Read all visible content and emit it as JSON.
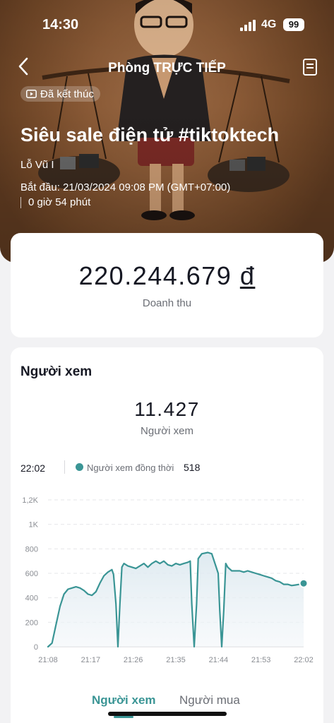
{
  "status_bar": {
    "time": "14:30",
    "network": "4G",
    "battery": "99"
  },
  "nav": {
    "title": "Phòng TRỰC TIẾP"
  },
  "live": {
    "status_badge": "Đã kết thúc",
    "title": "Siêu sale điện tử #tiktoktech",
    "host": "Lỗ Vũ I",
    "start_time": "Bắt đầu: 21/03/2024 09:08 PM (GMT+07:00)",
    "duration": "0 giờ 54 phút"
  },
  "revenue": {
    "amount": "220.244.679",
    "currency": "đ",
    "label": "Doanh thu"
  },
  "viewers": {
    "section_title": "Người xem",
    "total": "11.427",
    "total_label": "Người xem",
    "tooltip": {
      "time": "22:02",
      "series_label": "Người xem đồng thời",
      "value": "518"
    }
  },
  "chart_data": {
    "type": "line",
    "series": [
      {
        "name": "Người xem đồng thời",
        "color": "#3a9595",
        "points": [
          [
            0,
            0
          ],
          [
            1,
            30
          ],
          [
            2,
            180
          ],
          [
            3,
            330
          ],
          [
            4,
            430
          ],
          [
            5,
            470
          ],
          [
            6,
            480
          ],
          [
            7,
            490
          ],
          [
            8,
            480
          ],
          [
            9,
            460
          ],
          [
            10,
            430
          ],
          [
            11,
            420
          ],
          [
            12,
            450
          ],
          [
            13,
            520
          ],
          [
            14,
            580
          ],
          [
            15,
            610
          ],
          [
            16,
            630
          ],
          [
            16.4,
            590
          ],
          [
            17,
            350
          ],
          [
            17.5,
            0
          ],
          [
            18,
            350
          ],
          [
            18.5,
            650
          ],
          [
            19,
            680
          ],
          [
            20,
            660
          ],
          [
            21,
            650
          ],
          [
            22,
            640
          ],
          [
            23,
            660
          ],
          [
            24,
            680
          ],
          [
            25,
            650
          ],
          [
            26,
            680
          ],
          [
            27,
            700
          ],
          [
            28,
            680
          ],
          [
            29,
            700
          ],
          [
            30,
            670
          ],
          [
            31,
            660
          ],
          [
            32,
            680
          ],
          [
            33,
            670
          ],
          [
            34,
            680
          ],
          [
            35,
            690
          ],
          [
            35.6,
            700
          ],
          [
            36,
            350
          ],
          [
            36.6,
            0
          ],
          [
            37.2,
            350
          ],
          [
            37.6,
            720
          ],
          [
            38.5,
            760
          ],
          [
            40,
            770
          ],
          [
            41,
            760
          ],
          [
            42,
            660
          ],
          [
            42.6,
            600
          ],
          [
            43,
            300
          ],
          [
            43.5,
            0
          ],
          [
            44,
            300
          ],
          [
            44.5,
            680
          ],
          [
            45,
            650
          ],
          [
            46,
            620
          ],
          [
            47,
            620
          ],
          [
            48,
            620
          ],
          [
            49,
            610
          ],
          [
            50,
            620
          ],
          [
            51,
            610
          ],
          [
            52,
            600
          ],
          [
            53,
            590
          ],
          [
            54,
            580
          ],
          [
            55,
            570
          ],
          [
            56,
            560
          ],
          [
            57,
            540
          ],
          [
            58,
            530
          ],
          [
            59,
            510
          ],
          [
            60,
            510
          ],
          [
            61,
            500
          ],
          [
            62,
            505
          ],
          [
            63,
            510
          ],
          [
            64,
            518
          ]
        ]
      }
    ],
    "x_ticks": [
      "21:08",
      "21:17",
      "21:26",
      "21:35",
      "21:44",
      "21:53",
      "22:02"
    ],
    "y_ticks": [
      "0",
      "200",
      "400",
      "600",
      "800",
      "1K",
      "1,2K"
    ],
    "y_tick_values": [
      0,
      200,
      400,
      600,
      800,
      1000,
      1200
    ],
    "xlim": [
      0,
      54
    ],
    "ylim": [
      0,
      1200
    ],
    "grid": true,
    "area_fill": true,
    "highlight_last_point": true
  },
  "tabs": [
    {
      "label": "Người xem",
      "active": true
    },
    {
      "label": "Người mua",
      "active": false
    }
  ]
}
